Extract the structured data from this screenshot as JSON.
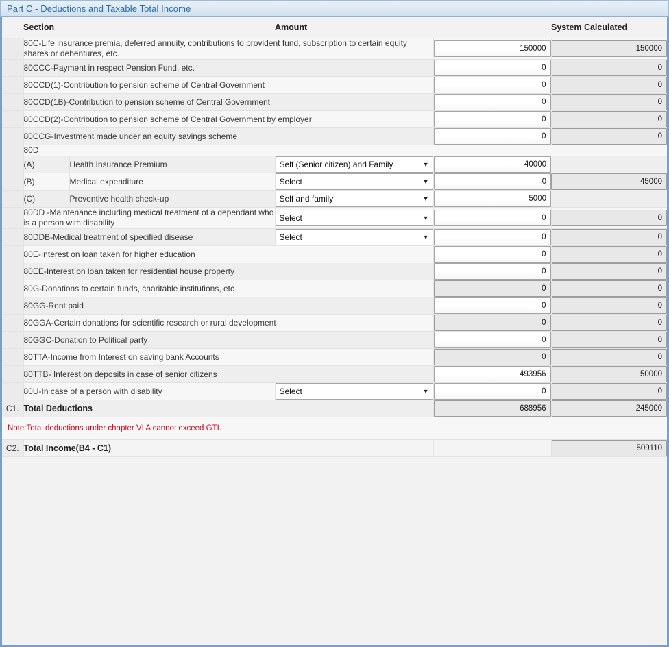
{
  "panel": {
    "title": "Part C - Deductions and Taxable Total Income"
  },
  "columns": {
    "section": "Section",
    "amount": "Amount",
    "system_calculated": "System Calculated"
  },
  "rows": [
    {
      "label": "80C-Life insurance premia, deferred annuity, contributions to provident fund, subscription to certain equity shares or debentures, etc.",
      "amount": "150000",
      "amount_readonly": false,
      "system": "150000"
    },
    {
      "label": "80CCC-Payment in respect Pension Fund, etc.",
      "amount": "0",
      "amount_readonly": false,
      "system": "0"
    },
    {
      "label": "80CCD(1)-Contribution to pension scheme of Central Government",
      "amount": "0",
      "amount_readonly": false,
      "system": "0"
    },
    {
      "label": "80CCD(1B)-Contribution to pension scheme of Central Government",
      "amount": "0",
      "amount_readonly": false,
      "system": "0"
    },
    {
      "label": "80CCD(2)-Contribution to pension scheme of Central Government by employer",
      "amount": "0",
      "amount_readonly": false,
      "system": "0"
    },
    {
      "label": "80CCG-Investment made under an equity savings scheme",
      "amount": "0",
      "amount_readonly": false,
      "system": "0"
    }
  ],
  "section80d": {
    "header": "80D",
    "merged_system": "45000",
    "sub_rows": [
      {
        "marker": "(A)",
        "label": "Health Insurance Premium",
        "select": "Self (Senior citizen) and Family",
        "amount": "40000"
      },
      {
        "marker": "(B)",
        "label": "Medical expenditure",
        "select": "Select",
        "amount": "0"
      },
      {
        "marker": "(C)",
        "label": "Preventive health check-up",
        "select": "Self and family",
        "amount": "5000"
      }
    ]
  },
  "select_rows": [
    {
      "label": "80DD -Maintenance including medical treatment of a dependant who is a person with disability",
      "select": "Select",
      "amount": "0",
      "amount_readonly": false,
      "system": "0"
    },
    {
      "label": "80DDB-Medical treatment of specified disease",
      "select": "Select",
      "amount": "0",
      "amount_readonly": false,
      "system": "0"
    }
  ],
  "rows2": [
    {
      "label": "80E-Interest on loan taken for higher education",
      "amount": "0",
      "amount_readonly": false,
      "system": "0"
    },
    {
      "label": "80EE-Interest on loan taken for residential house property",
      "amount": "0",
      "amount_readonly": false,
      "system": "0"
    },
    {
      "label": "80G-Donations to certain funds, charitable institutions, etc",
      "amount": "0",
      "amount_readonly": true,
      "system": "0"
    },
    {
      "label": "80GG-Rent paid",
      "amount": "0",
      "amount_readonly": false,
      "system": "0"
    },
    {
      "label": "80GGA-Certain donations for scientific research or rural development",
      "amount": "0",
      "amount_readonly": true,
      "system": "0"
    },
    {
      "label": "80GGC-Donation to Political party",
      "amount": "0",
      "amount_readonly": false,
      "system": "0"
    },
    {
      "label": "80TTA-Income from Interest on saving bank Accounts",
      "amount": "0",
      "amount_readonly": true,
      "system": "0"
    },
    {
      "label": "80TTB- Interest on deposits in case of senior citizens",
      "amount": "493956",
      "amount_readonly": false,
      "system": "50000"
    }
  ],
  "row_80u": {
    "label": "80U-In case of a person with disability",
    "select": "Select",
    "amount": "0",
    "system": "0"
  },
  "totals": {
    "c1_marker": "C1.",
    "c1_label": "Total Deductions",
    "c1_amount": "688956",
    "c1_system": "245000",
    "note": "Note:Total deductions under chapter VI A cannot exceed GTI.",
    "c2_marker": "C2.",
    "c2_label": "Total Income(B4 - C1)",
    "c2_system": "509110"
  },
  "icons": {
    "chevron_down": "▼"
  },
  "colors": {
    "header_text": "#2b6ca3",
    "panel_border": "#7a9ec4",
    "note_text": "#d0021b"
  }
}
